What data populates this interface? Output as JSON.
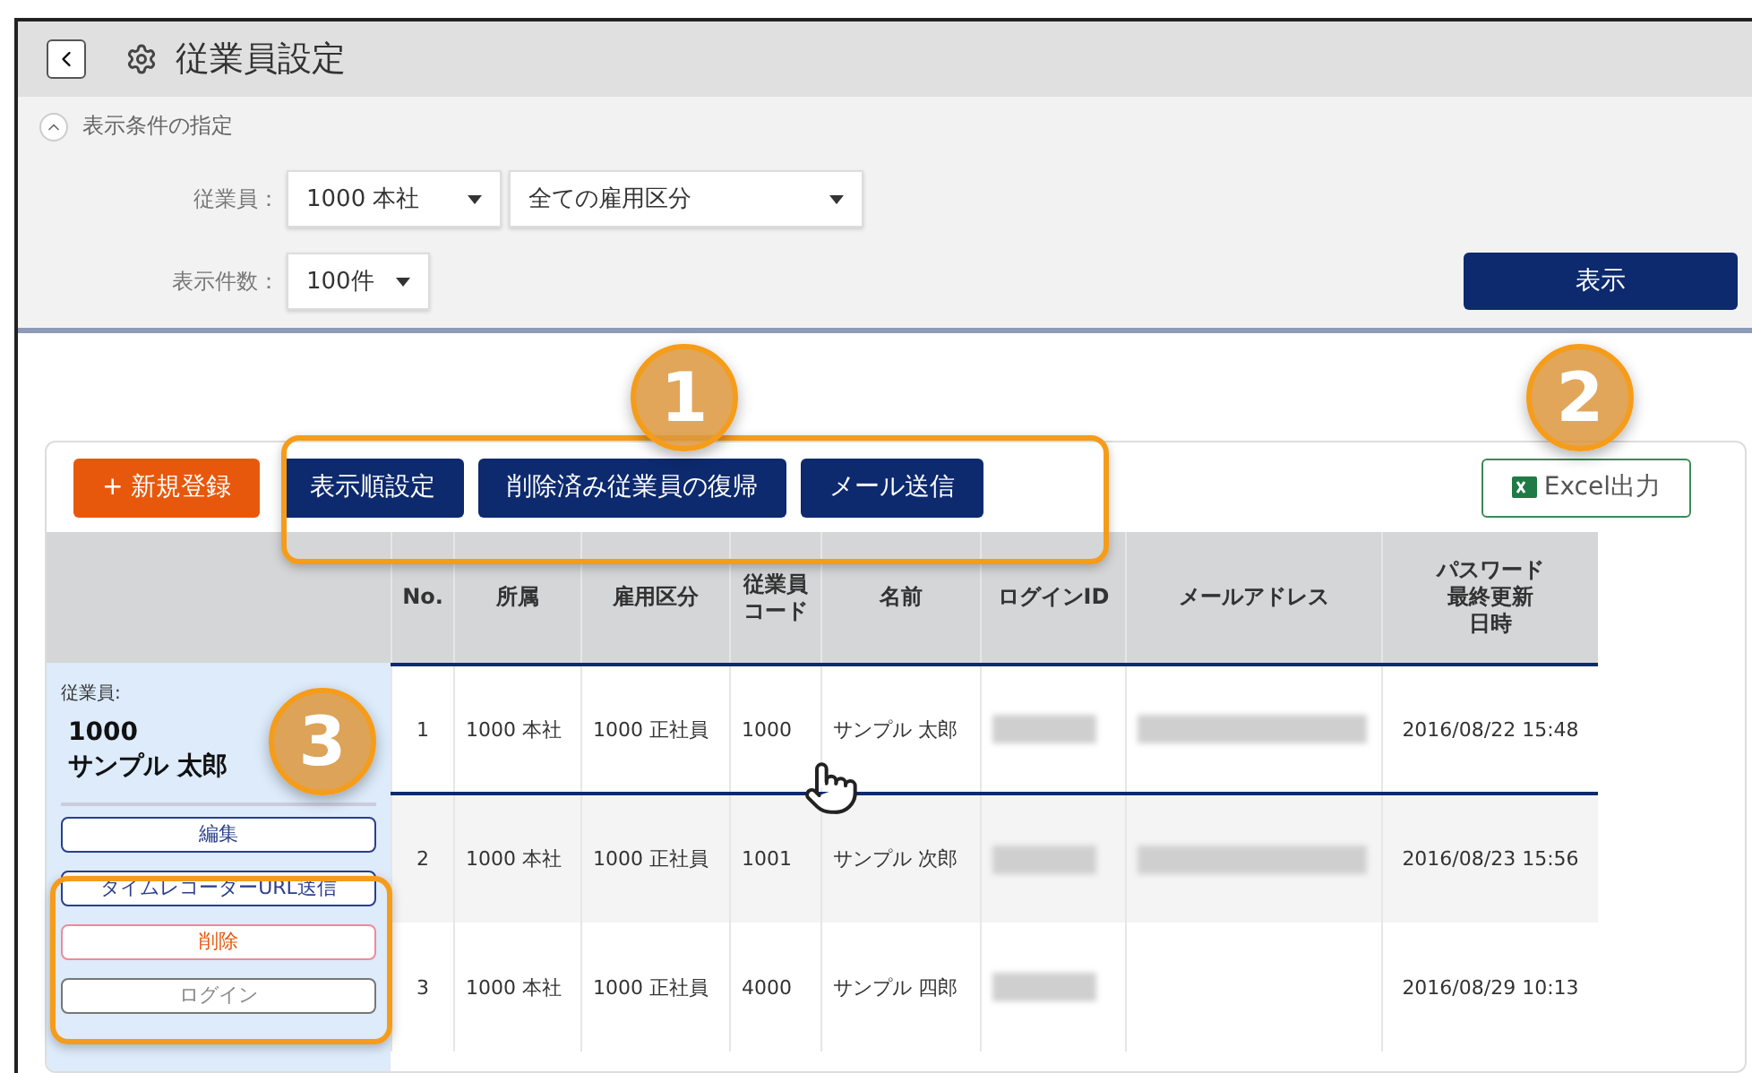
{
  "header": {
    "title": "従業員設定"
  },
  "filter": {
    "toggle_label": "表示条件の指定",
    "expanded": true,
    "fields": [
      {
        "label": "従業員：",
        "selects": [
          {
            "value": "1000 本社"
          },
          {
            "value": "全ての雇用区分"
          }
        ]
      },
      {
        "label": "表示件数：",
        "selects": [
          {
            "value": "100件"
          }
        ]
      }
    ],
    "submit": "表示"
  },
  "toolbar": {
    "buttons": [
      {
        "label": "+ 新規登録",
        "kind": "create"
      },
      {
        "label": "表示順設定",
        "kind": "navy"
      },
      {
        "label": "削除済み従業員の復帰",
        "kind": "navy"
      },
      {
        "label": "メール送信",
        "kind": "navy"
      },
      {
        "label": "Excel出力",
        "kind": "excel"
      }
    ]
  },
  "table": {
    "columns": [
      [
        "No."
      ],
      [
        "所属"
      ],
      [
        "雇用区分"
      ],
      [
        "従業員",
        "コード"
      ],
      [
        "名前"
      ],
      [
        "ログインID"
      ],
      [
        "メールアドレス"
      ],
      [
        "パスワード",
        "最終更新",
        "日時"
      ]
    ],
    "rows": [
      {
        "no": "1",
        "dept": "1000 本社",
        "employment": "1000 正社員",
        "code": "1000",
        "name": "サンプル 太郎",
        "login_id_hidden": true,
        "email_hidden": true,
        "updated": "2016/08/22 15:48",
        "selected": true
      },
      {
        "no": "2",
        "dept": "1000 本社",
        "employment": "1000 正社員",
        "code": "1001",
        "name": "サンプル 次郎",
        "login_id_hidden": true,
        "email_hidden": true,
        "updated": "2016/08/23 15:56",
        "selected": false
      },
      {
        "no": "3",
        "dept": "1000 本社",
        "employment": "1000 正社員",
        "code": "4000",
        "name": "サンプル 四郎",
        "login_id_hidden": true,
        "email_hidden": false,
        "updated": "2016/08/29 10:13",
        "selected": false
      }
    ]
  },
  "side_panel": {
    "caption": "従業員:",
    "code": "1000",
    "name": "サンプル 太郎",
    "actions": [
      {
        "label": "編集",
        "kind": "normal"
      },
      {
        "label": "タイムレコーダーURL送信",
        "kind": "normal"
      },
      {
        "label": "削除",
        "kind": "danger"
      },
      {
        "label": "ログイン",
        "kind": "muted"
      }
    ]
  },
  "callouts": [
    {
      "number": "1"
    },
    {
      "number": "2"
    },
    {
      "number": "3"
    }
  ]
}
